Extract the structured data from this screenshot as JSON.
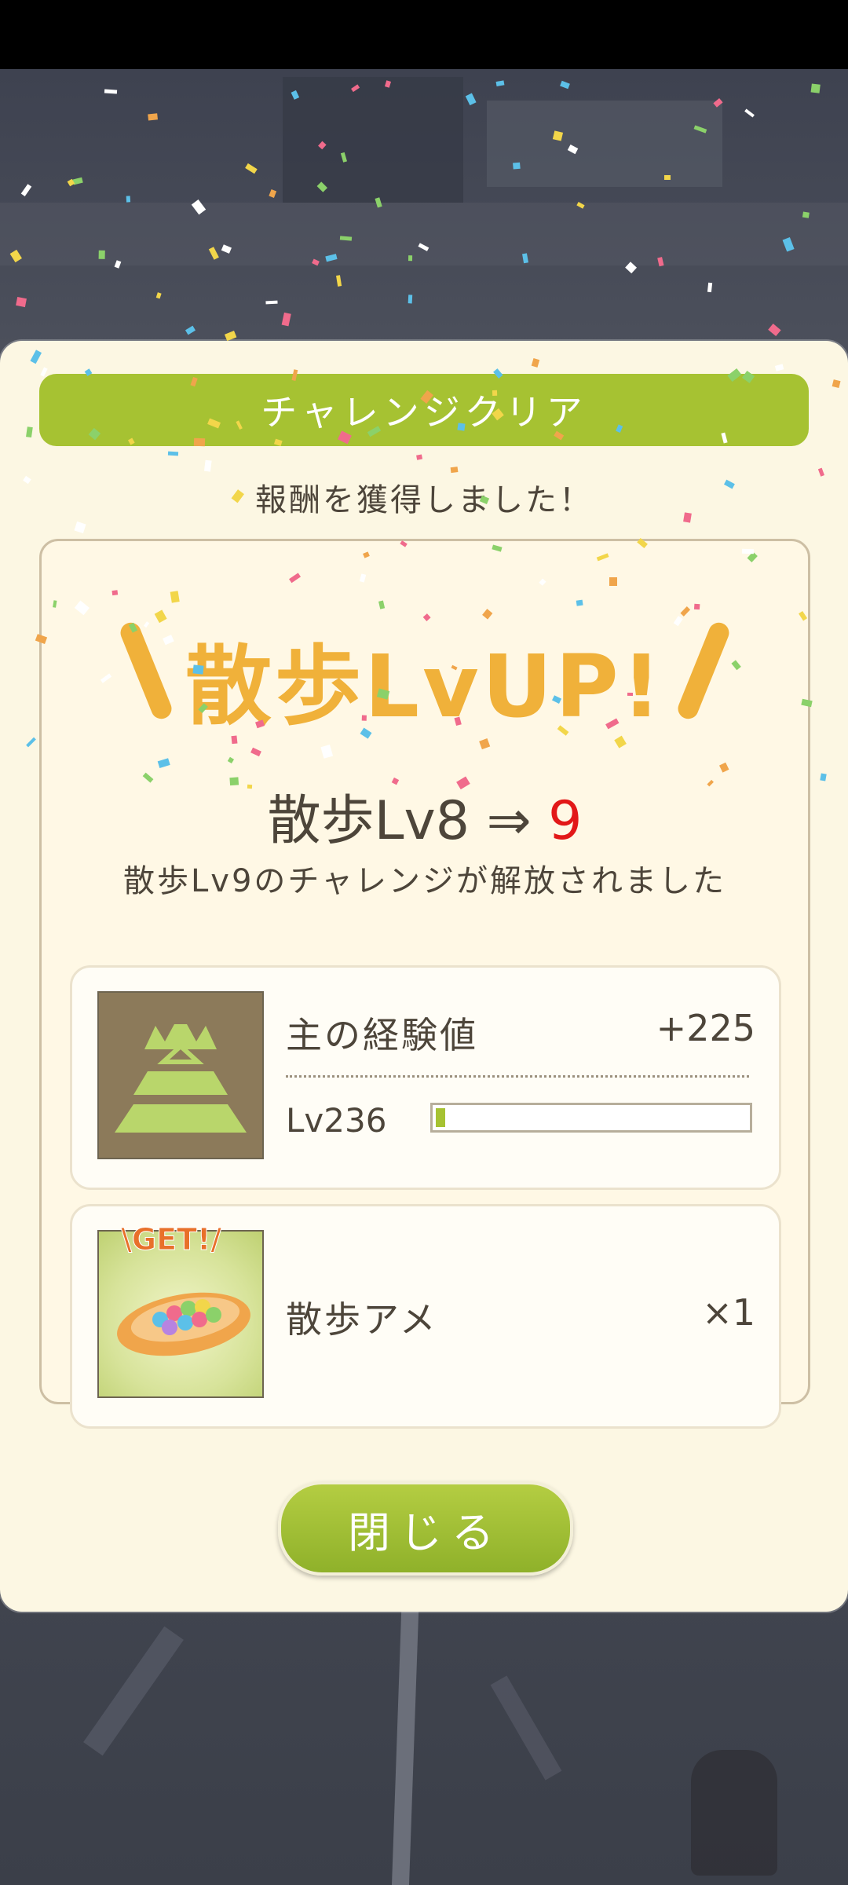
{
  "dialog": {
    "title": "チャレンジクリア",
    "subtitle": "報酬を獲得しました！",
    "banner": "散歩LvUP!",
    "level_prefix": "散歩Lv8 ⇒ ",
    "level_new": "9",
    "unlock_message": "散歩Lv9のチャレンジが解放されました",
    "close_label": "閉じる"
  },
  "rewards": [
    {
      "name": "主の経験値",
      "amount": "+225",
      "icon": "castle-icon",
      "level_label": "Lv236",
      "progress_percent": 3
    },
    {
      "name": "散歩アメ",
      "amount": "×1",
      "icon": "candy-plate-icon",
      "badge": "\\GET!/"
    }
  ],
  "colors": {
    "accent_green": "#a6c232",
    "banner_orange": "#f0b13a",
    "level_red": "#e21818",
    "panel_bg": "#fcf7e3"
  }
}
